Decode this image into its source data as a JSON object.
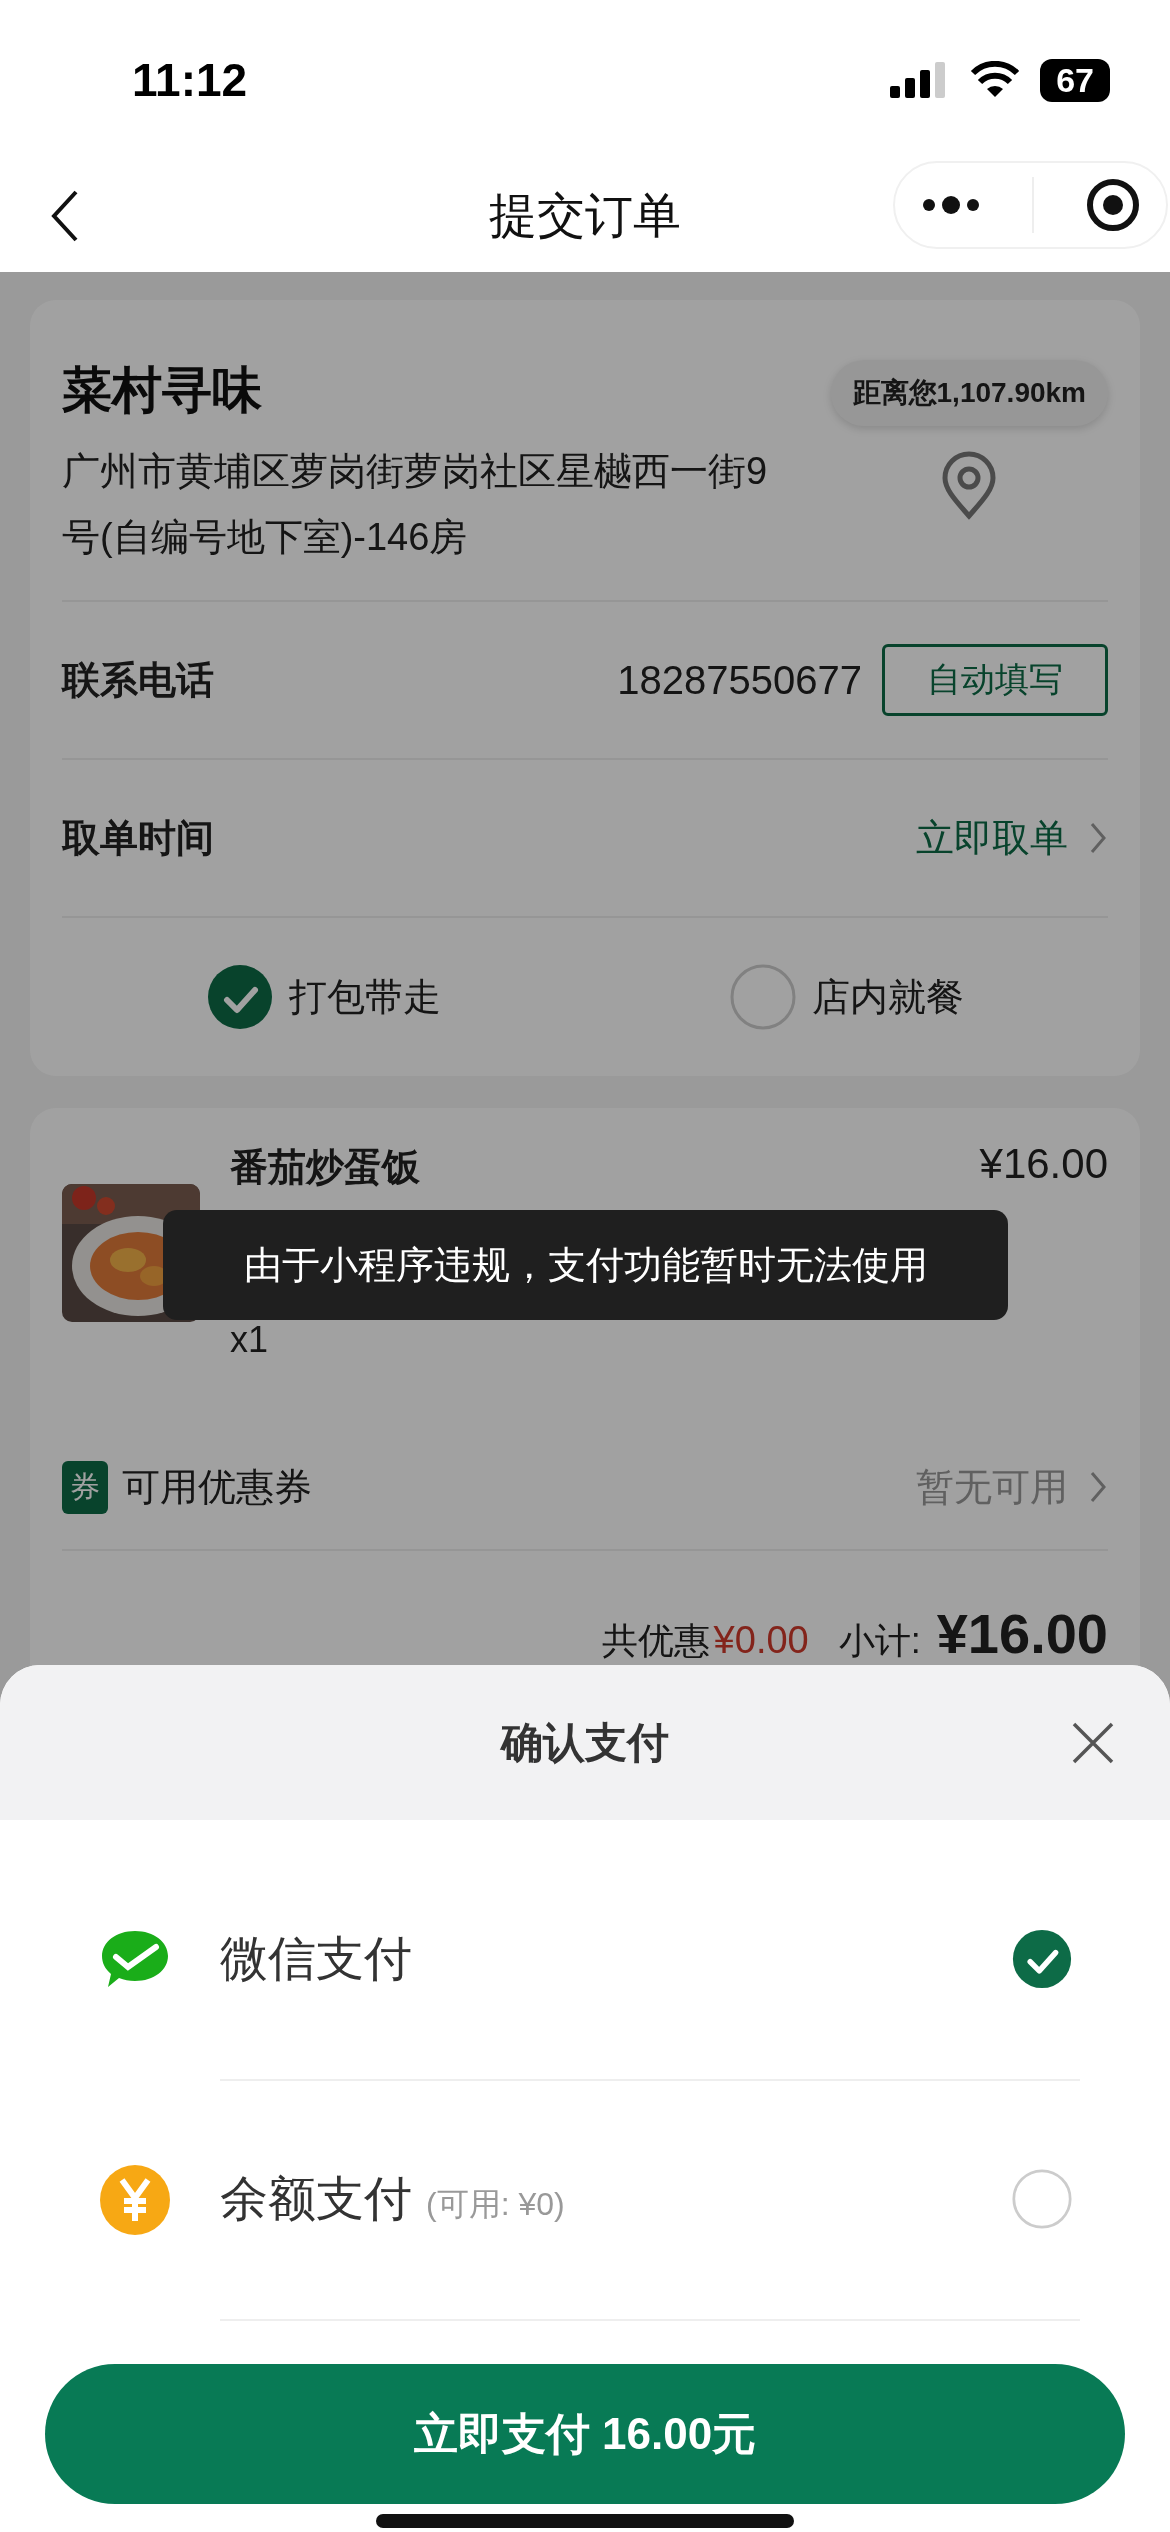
{
  "status_bar": {
    "time": "11:12",
    "battery": "67"
  },
  "nav": {
    "title": "提交订单"
  },
  "store": {
    "name": "菜村寻味",
    "distance": "距离您1,107.90km",
    "address": "广州市黄埔区萝岗街萝岗社区星樾西一街9号(自编号地下室)-146房"
  },
  "phone": {
    "label": "联系电话",
    "value": "18287550677",
    "button": "自动填写"
  },
  "pickup": {
    "label": "取单时间",
    "value": "立即取单"
  },
  "dining_options": [
    {
      "label": "打包带走",
      "selected": true
    },
    {
      "label": "店内就餐",
      "selected": false
    }
  ],
  "items": [
    {
      "kind": "picture",
      "name": "番茄炒蛋饭",
      "price": "¥16.00",
      "quantity": "x1"
    }
  ],
  "coupon": {
    "badge": "券",
    "label": "可用优惠券",
    "value": "暂无可用"
  },
  "summary": {
    "discount_label": "共优惠",
    "discount": "¥0.00",
    "subtotal_label": "小计:",
    "subtotal": "¥16.00"
  },
  "toast": {
    "message": "由于小程序违规，支付功能暂时无法使用"
  },
  "payment_sheet": {
    "title": "确认支付",
    "methods": [
      {
        "kind": "wechat",
        "label": "微信支付",
        "selected": true
      },
      {
        "kind": "balance",
        "label": "余额支付",
        "note": "(可用: ¥0)",
        "selected": false
      }
    ],
    "pay_button": "立即支付 16.00元"
  }
}
